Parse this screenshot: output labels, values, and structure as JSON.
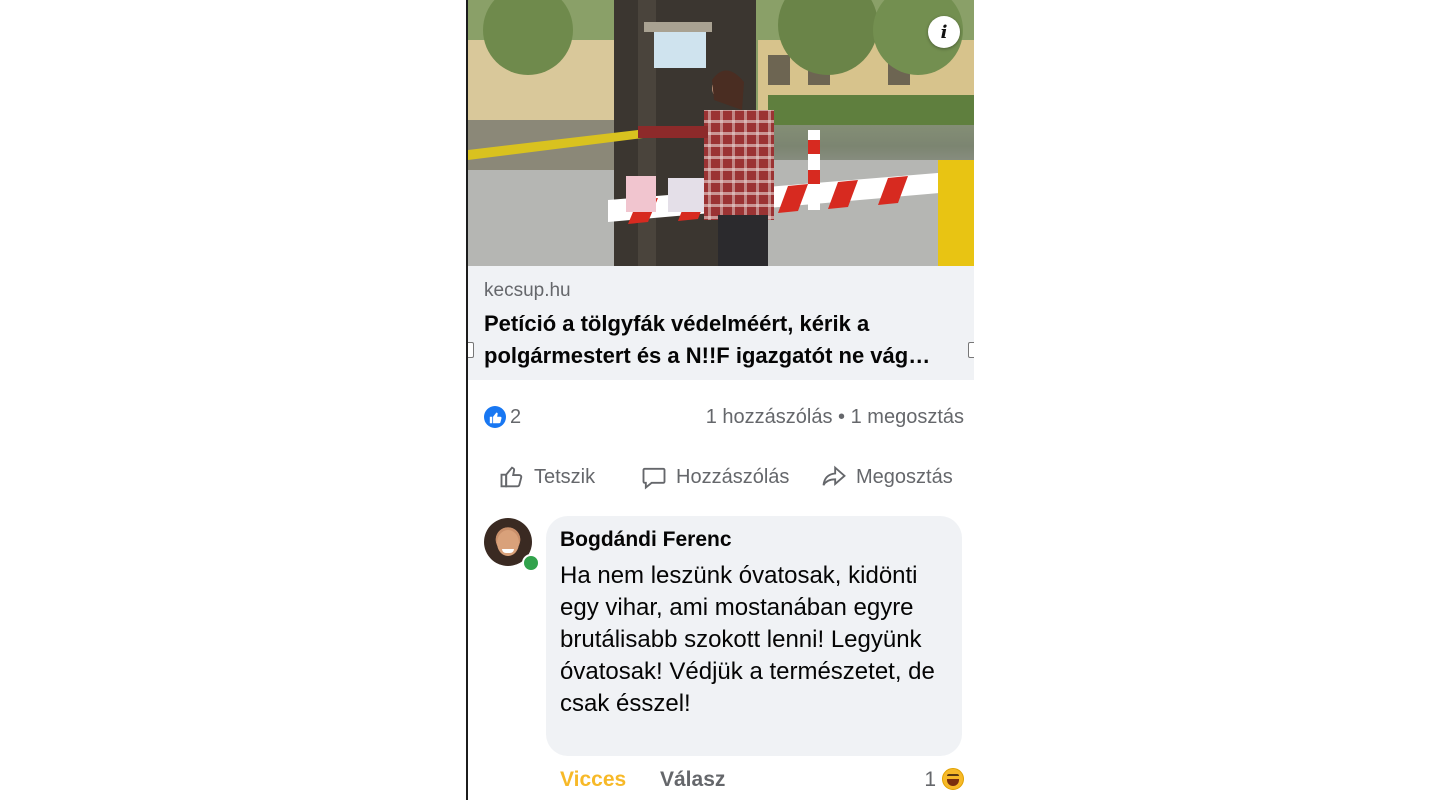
{
  "post": {
    "image_alt": "Photo: woman hugging an oak tree behind striped barrier tape",
    "link": {
      "domain": "kecsup.hu",
      "title": "Petíció a tölgyfák védelméért, kérik a polgármestert és a N!!F igazgatót ne vág…"
    },
    "stats": {
      "like_count": "2",
      "comments_shares": "1 hozzászólás • 1 megosztás"
    },
    "actions": {
      "like_label": "Tetszik",
      "comment_label": "Hozzászólás",
      "share_label": "Megosztás"
    }
  },
  "comment": {
    "author": "Bogdándi Ferenc",
    "text": "Ha nem leszünk óvatosak, kidönti egy vihar, ami mostanában egyre brutálisabb szokott lenni! Legyünk óvatosak! Védjük a természetet, de csak ésszel!",
    "reaction_label": "Vicces",
    "reply_label": "Válasz",
    "reaction_count": "1"
  },
  "colors": {
    "accent_blue": "#1877f2",
    "haha_yellow": "#f7b928",
    "secondary_text": "#65676b",
    "bubble_bg": "#f0f2f5",
    "online_green": "#31a24c"
  },
  "icons": {
    "info": "info-icon",
    "like_badge": "thumbs-up-icon",
    "like_action": "thumbs-up-outline-icon",
    "comment_action": "speech-bubble-icon",
    "share_action": "share-arrow-icon",
    "reaction": "haha-emoji-icon"
  }
}
